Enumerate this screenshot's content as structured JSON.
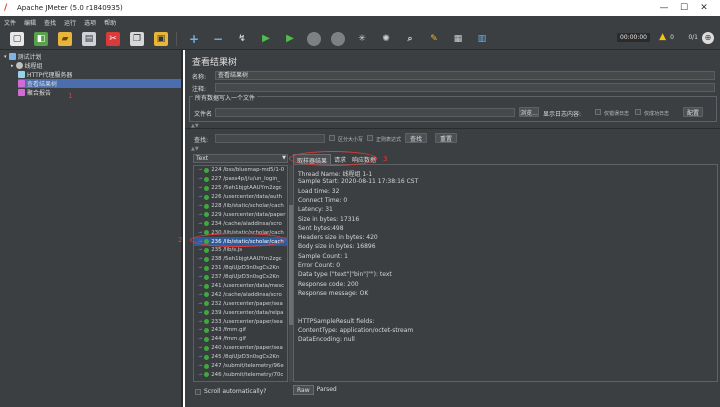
{
  "window": {
    "title": "Apache JMeter (5.0 r1840935)",
    "min": "—",
    "max": "☐",
    "close": "✕"
  },
  "menu": [
    "文件",
    "编辑",
    "查找",
    "运行",
    "选项",
    "帮助"
  ],
  "toolbar": {
    "timer": "00:00:00",
    "warn_count": "0",
    "threads": "0/1"
  },
  "tree": [
    {
      "label": "测试计划",
      "icon": "test-plan-icon",
      "color": "#7fb3e6"
    },
    {
      "label": "线程组",
      "icon": "gear-icon",
      "color": "#c0c0c0"
    },
    {
      "label": "HTTP代理服务器",
      "icon": "proxy-icon",
      "color": "#9ad0ec"
    },
    {
      "label": "查看结果树",
      "icon": "results-tree-icon",
      "color": "#d36ad6"
    },
    {
      "label": "聚合报告",
      "icon": "report-icon",
      "color": "#d36ad6"
    }
  ],
  "annotations": [
    "1",
    "2",
    "3"
  ],
  "panel": {
    "title": "查看结果树",
    "name_label": "名称:",
    "name_value": "查看结果树",
    "comment_label": "注释:",
    "group_title": "所有数据写入一个文件",
    "filename_label": "文件名",
    "browse": "浏览...",
    "log_label": "显示日志内容:",
    "errors_only": "仅错误日志",
    "success_only": "仅成功日志",
    "configure": "配置",
    "search_label": "查找:",
    "case_sensitive": "区分大小写",
    "regex": "正则表达式",
    "find_btn": "查找",
    "reset_btn": "重置",
    "renderer": "Text",
    "scroll_auto": "Scroll automatically?"
  },
  "tabs": [
    "取样器结果",
    "请求",
    "响应数据"
  ],
  "bottom_tabs": [
    "Raw",
    "Parsed"
  ],
  "samples": [
    "224 /bss/bluemap-md5/1-0",
    "227 /pass4p/j/u/un_login_",
    "225 /5eh1bjgtAAUYm2zgc",
    "226 /usercenter/data/auth",
    "228 /lib/static/scholar/cach",
    "229 /usercenter/data/paper",
    "234 /cache/aladdinsa/scro",
    "230 /lib/static/scholar/cach",
    "236 /lib/static/scholar/cach",
    "235 /lib/s.js",
    "238 /5eh1bjgtAAUYm2zgc",
    "231 /8qiUJzD3n0sgCs2Kn",
    "237 /8qiUJzD3n0sgCs2Kn",
    "241 /usercenter/data/mesc",
    "242 /cache/aladdinsa/scro",
    "232 /usercenter/paper/sea",
    "239 /usercenter/data/relpa",
    "233 /usercenter/paper/sea",
    "243 /fmm.gif",
    "244 /fmm.gif",
    "240 /usercenter/paper/sea",
    "245 /8qiUJzD3n0sgCs2Kn",
    "247 /submit/telemetry/96e",
    "246 /submit/telemetry/70c"
  ],
  "selected_sample": 8,
  "result_lines": [
    "Thread Name: 线程组 1-1",
    "Sample Start: 2020-08-11 17:38:16 CST",
    "Load time: 32",
    "Connect Time: 0",
    "Latency: 31",
    "Size in bytes: 17316",
    "Sent bytes:498",
    "Headers size in bytes: 420",
    "Body size in bytes: 16896",
    "Sample Count: 1",
    "Error Count: 0",
    "Data type (\"text\"|\"bin\"|\"\"): text",
    "Response code: 200",
    "Response message: OK",
    "",
    "",
    "HTTPSampleResult fields:",
    "ContentType: application/octet-stream",
    "DataEncoding: null"
  ]
}
